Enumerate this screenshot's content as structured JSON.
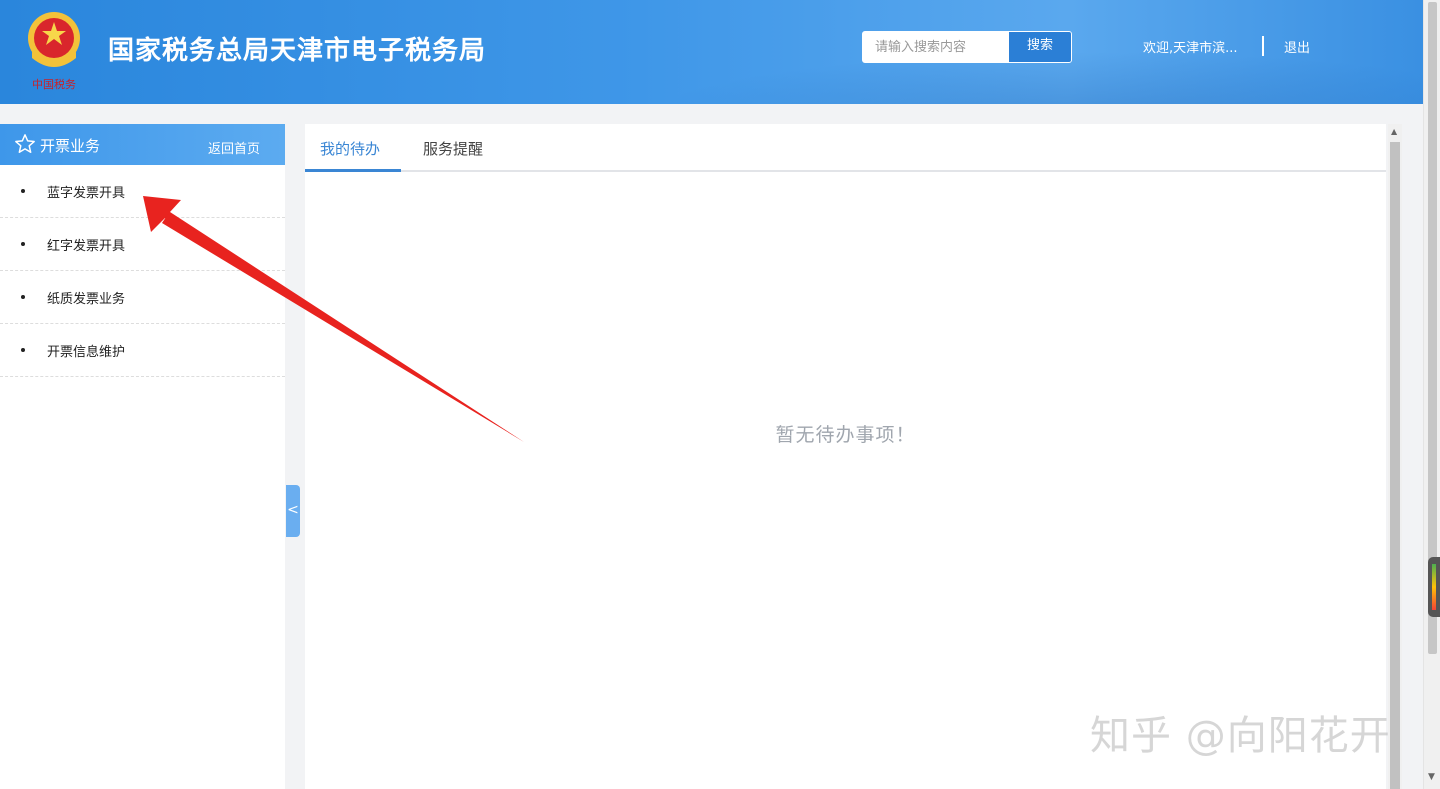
{
  "header": {
    "site_title": "国家税务总局天津市电子税务局",
    "emblem_text": "中国税务",
    "search_placeholder": "请输入搜索内容",
    "search_button": "搜索",
    "welcome": "欢迎,天津市滨...",
    "logout": "退出"
  },
  "sidebar": {
    "title": "开票业务",
    "home_link": "返回首页",
    "items": [
      {
        "label": "蓝字发票开具"
      },
      {
        "label": "红字发票开具"
      },
      {
        "label": "纸质发票业务"
      },
      {
        "label": "开票信息维护"
      }
    ],
    "collapse_label": "<"
  },
  "main": {
    "tabs": [
      {
        "label": "我的待办",
        "active": true
      },
      {
        "label": "服务提醒",
        "active": false
      }
    ],
    "empty_message": "暂无待办事项！"
  },
  "watermark": "知乎 @向阳花开",
  "colors": {
    "header_blue": "#2a86dc",
    "accent": "#3a86d4",
    "annotation_arrow": "#e8231f"
  },
  "icons": [
    "emblem-logo",
    "star-icon",
    "collapse-arrow-icon"
  ]
}
